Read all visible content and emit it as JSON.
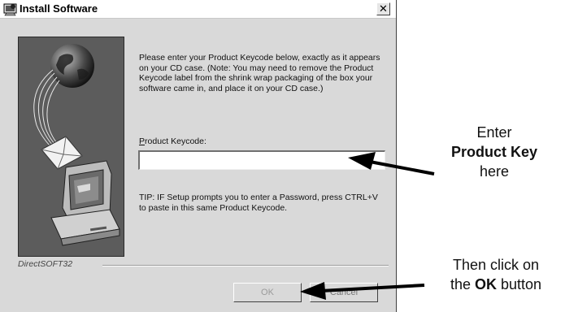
{
  "window": {
    "title": "Install Software",
    "close_glyph": "✕"
  },
  "content": {
    "instructions": "Please enter your Product Keycode below, exactly as it appears on your CD case.  (Note:  You may need to remove the Product Keycode label from the shrink wrap packaging of the box your software came in, and place it on your CD case.)",
    "keycode_label_accel": "P",
    "keycode_label_rest": "roduct Keycode:",
    "keycode_value": "",
    "tip": "TIP:  IF Setup prompts you to enter a Password, press CTRL+V to paste in this same Product Keycode."
  },
  "footer": {
    "brand": "DirectSOFT32",
    "ok_label": "OK",
    "cancel_label": "Cancel"
  },
  "annotations": {
    "callout_1": {
      "line1": "Enter",
      "bold": "Product Key",
      "line3": "here"
    },
    "callout_2": {
      "prefix_line": "Then click on",
      "pre": "the ",
      "bold": "OK",
      "post": " button"
    }
  },
  "icons": [
    "app-icon",
    "globe-icon",
    "envelope-icon",
    "computer-icon",
    "close-icon",
    "arrow-icon"
  ],
  "colors": {
    "dialog_bg": "#d9d9d9",
    "art_bg": "#5c5c5c",
    "arrow": "#000000"
  }
}
